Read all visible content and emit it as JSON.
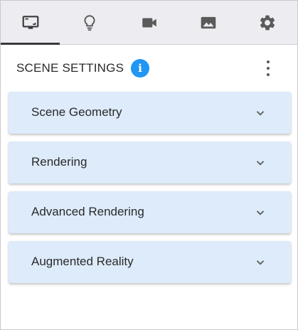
{
  "tabs": [
    {
      "icon": "monitor-icon",
      "active": true
    },
    {
      "icon": "lightbulb-icon",
      "active": false
    },
    {
      "icon": "video-camera-icon",
      "active": false
    },
    {
      "icon": "image-icon",
      "active": false
    },
    {
      "icon": "gear-icon",
      "active": false
    }
  ],
  "header": {
    "title": "SCENE SETTINGS",
    "info_icon": "info-icon",
    "info_glyph": "i",
    "menu_icon": "more-vertical-icon"
  },
  "sections": [
    {
      "label": "Scene Geometry",
      "expanded": false
    },
    {
      "label": "Rendering",
      "expanded": false
    },
    {
      "label": "Advanced Rendering",
      "expanded": false
    },
    {
      "label": "Augmented Reality",
      "expanded": false
    }
  ],
  "colors": {
    "tabbar_bg": "#ececf1",
    "accordion_bg": "#ddebfb",
    "info_blue": "#2196f3",
    "icon_gray": "#5a5a5a"
  }
}
